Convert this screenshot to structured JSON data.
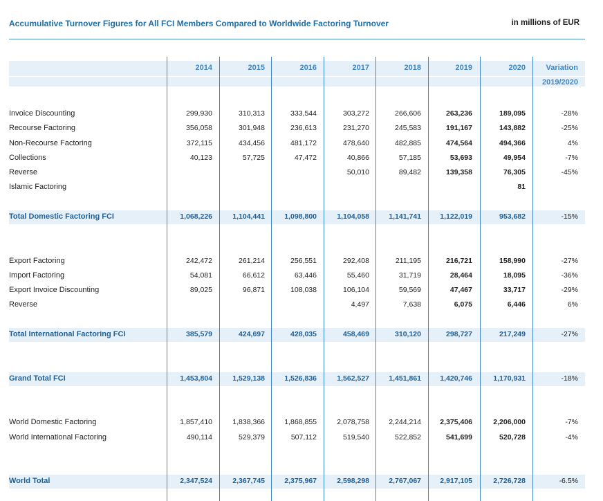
{
  "title": "Accumulative Turnover Figures for All FCI Members Compared to Worldwide Factoring Turnover",
  "unit": "in millions of EUR",
  "columns": [
    "2014",
    "2015",
    "2016",
    "2017",
    "2018",
    "2019",
    "2020"
  ],
  "variation_header": [
    "Variation",
    "2019/2020"
  ],
  "rows": [
    {
      "label": "Invoice Discounting",
      "values": [
        "299,930",
        "310,313",
        "333,544",
        "303,272",
        "266,606",
        "263,236",
        "189,095"
      ],
      "variation": "-28%",
      "total": false
    },
    {
      "label": "Recourse Factoring",
      "values": [
        "356,058",
        "301,948",
        "236,613",
        "231,270",
        "245,583",
        "191,167",
        "143,882"
      ],
      "variation": "-25%",
      "total": false
    },
    {
      "label": "Non-Recourse Factoring",
      "values": [
        "372,115",
        "434,456",
        "481,172",
        "478,640",
        "482,885",
        "474,564",
        "494,366"
      ],
      "variation": "4%",
      "total": false
    },
    {
      "label": "Collections",
      "values": [
        "40,123",
        "57,725",
        "47,472",
        "40,866",
        "57,185",
        "53,693",
        "49,954"
      ],
      "variation": "-7%",
      "total": false
    },
    {
      "label": "Reverse",
      "values": [
        "",
        "",
        "",
        "50,010",
        "89,482",
        "139,358",
        "76,305"
      ],
      "variation": "-45%",
      "total": false
    },
    {
      "label": "Islamic Factoring",
      "values": [
        "",
        "",
        "",
        "",
        "",
        "",
        "81"
      ],
      "variation": "",
      "total": false
    },
    {
      "label": "Total Domestic Factoring FCI",
      "values": [
        "1,068,226",
        "1,104,441",
        "1,098,800",
        "1,104,058",
        "1,141,741",
        "1,122,019",
        "953,682"
      ],
      "variation": "-15%",
      "total": true
    },
    {
      "label": "Export Factoring",
      "values": [
        "242,472",
        "261,214",
        "256,551",
        "292,408",
        "211,195",
        "216,721",
        "158,990"
      ],
      "variation": "-27%",
      "total": false
    },
    {
      "label": "Import Factoring",
      "values": [
        "54,081",
        "66,612",
        "63,446",
        "55,460",
        "31,719",
        "28,464",
        "18,095"
      ],
      "variation": "-36%",
      "total": false
    },
    {
      "label": "Export Invoice Discounting",
      "values": [
        "89,025",
        "96,871",
        "108,038",
        "106,104",
        "59,569",
        "47,467",
        "33,717"
      ],
      "variation": "-29%",
      "total": false
    },
    {
      "label": "Reverse",
      "values": [
        "",
        "",
        "",
        "4,497",
        "7,638",
        "6,075",
        "6,446"
      ],
      "variation": "6%",
      "total": false
    },
    {
      "label": "Total International Factoring FCI",
      "values": [
        "385,579",
        "424,697",
        "428,035",
        "458,469",
        "310,120",
        "298,727",
        "217,249"
      ],
      "variation": "-27%",
      "total": true
    },
    {
      "label": "Grand Total FCI",
      "values": [
        "1,453,804",
        "1,529,138",
        "1,526,836",
        "1,562,527",
        "1,451,861",
        "1,420,746",
        "1,170,931"
      ],
      "variation": "-18%",
      "total": true
    },
    {
      "label": "World Domestic Factoring",
      "values": [
        "1,857,410",
        "1,838,366",
        "1,868,855",
        "2,078,758",
        "2,244,214",
        "2,375,406",
        "2,206,000"
      ],
      "variation": "-7%",
      "total": false
    },
    {
      "label": "World International Factoring",
      "values": [
        "490,114",
        "529,379",
        "507,112",
        "519,540",
        "522,852",
        "541,699",
        "520,728"
      ],
      "variation": "-4%",
      "total": false
    },
    {
      "label": "World Total",
      "values": [
        "2,347,524",
        "2,367,745",
        "2,375,967",
        "2,598,298",
        "2,767,067",
        "2,917,105",
        "2,726,728"
      ],
      "variation": "-6.5%",
      "total": true
    }
  ],
  "colors": {
    "accent": "#3d86c6",
    "title": "#1f6fa8",
    "band": "#e6f0f9"
  }
}
